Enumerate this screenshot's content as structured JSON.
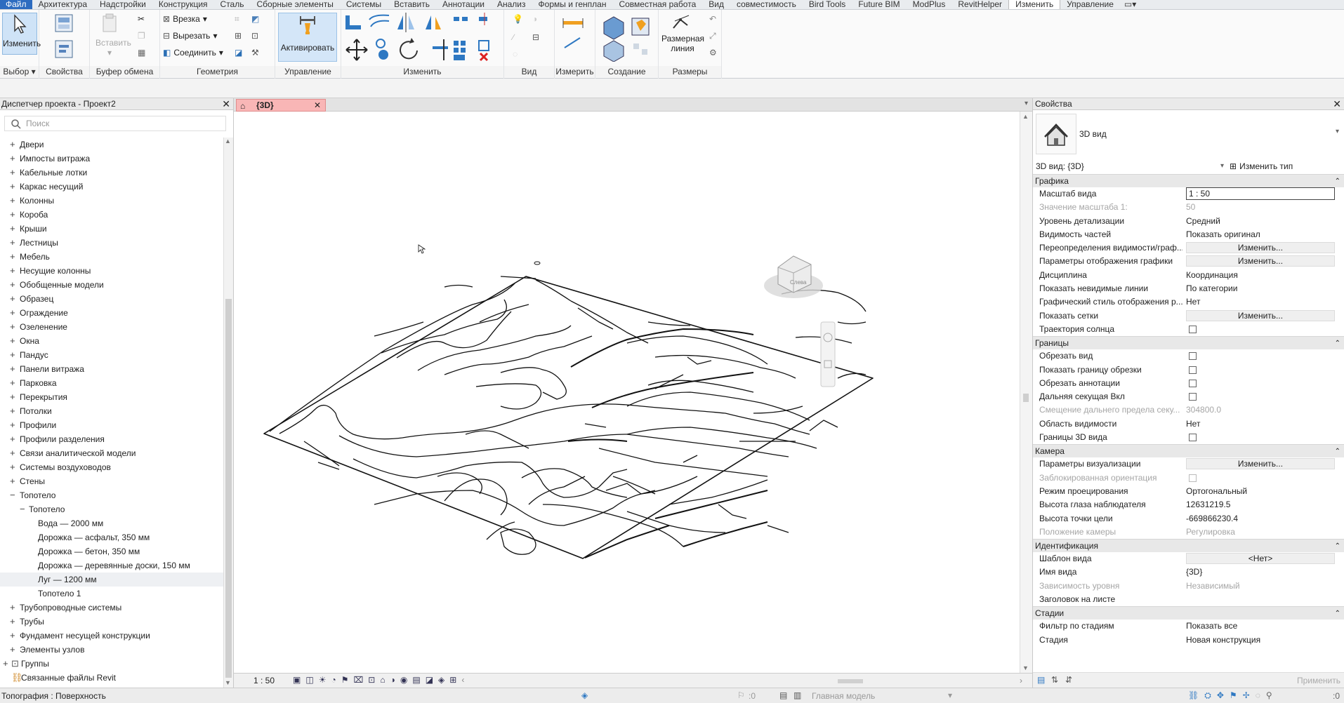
{
  "ribbon_tabs": [
    "Файл",
    "Архитектура",
    "Надстройки",
    "Конструкция",
    "Сталь",
    "Сборные элементы",
    "Системы",
    "Вставить",
    "Аннотации",
    "Анализ",
    "Формы и генплан",
    "Совместная работа",
    "Вид",
    "совместимость",
    "Bird Tools",
    "Future BIM",
    "ModPlus",
    "RevitHelper",
    "Изменить",
    "Управление"
  ],
  "ribbon": {
    "modify_label": "Изменить",
    "select_panel": "Выбор",
    "properties_panel": "Свойства",
    "clipboard_panel": "Буфер обмена",
    "paste_label": "Вставить",
    "cut_in_label": "Врезка",
    "cut_out_label": "Вырезать",
    "join_label": "Соединить",
    "geometry_panel": "Геометрия",
    "activate_label": "Активировать",
    "control_panel": "Управление",
    "modify_panel": "Изменить",
    "view_panel": "Вид",
    "measure_panel": "Измерить",
    "create_panel": "Создание",
    "dim_line_label_1": "Размерная",
    "dim_line_label_2": "линия",
    "dimensions_panel": "Размеры"
  },
  "browser": {
    "title": "Диспетчер проекта - Проект2",
    "search_placeholder": "Поиск",
    "items": [
      {
        "label": "Двери",
        "level": 1,
        "pm": "+"
      },
      {
        "label": "Импосты витража",
        "level": 1,
        "pm": "+"
      },
      {
        "label": "Кабельные лотки",
        "level": 1,
        "pm": "+"
      },
      {
        "label": "Каркас несущий",
        "level": 1,
        "pm": "+"
      },
      {
        "label": "Колонны",
        "level": 1,
        "pm": "+"
      },
      {
        "label": "Короба",
        "level": 1,
        "pm": "+"
      },
      {
        "label": "Крыши",
        "level": 1,
        "pm": "+"
      },
      {
        "label": "Лестницы",
        "level": 1,
        "pm": "+"
      },
      {
        "label": "Мебель",
        "level": 1,
        "pm": "+"
      },
      {
        "label": "Несущие колонны",
        "level": 1,
        "pm": "+"
      },
      {
        "label": "Обобщенные модели",
        "level": 1,
        "pm": "+"
      },
      {
        "label": "Образец",
        "level": 1,
        "pm": "+"
      },
      {
        "label": "Ограждение",
        "level": 1,
        "pm": "+"
      },
      {
        "label": "Озеленение",
        "level": 1,
        "pm": "+"
      },
      {
        "label": "Окна",
        "level": 1,
        "pm": "+"
      },
      {
        "label": "Пандус",
        "level": 1,
        "pm": "+"
      },
      {
        "label": "Панели витража",
        "level": 1,
        "pm": "+"
      },
      {
        "label": "Парковка",
        "level": 1,
        "pm": "+"
      },
      {
        "label": "Перекрытия",
        "level": 1,
        "pm": "+"
      },
      {
        "label": "Потолки",
        "level": 1,
        "pm": "+"
      },
      {
        "label": "Профили",
        "level": 1,
        "pm": "+"
      },
      {
        "label": "Профили разделения",
        "level": 1,
        "pm": "+"
      },
      {
        "label": "Связи аналитической модели",
        "level": 1,
        "pm": "+"
      },
      {
        "label": "Системы воздуховодов",
        "level": 1,
        "pm": "+"
      },
      {
        "label": "Стены",
        "level": 1,
        "pm": "+"
      },
      {
        "label": "Топотело",
        "level": 1,
        "pm": "−"
      },
      {
        "label": "Топотело",
        "level": 2,
        "pm": "−"
      },
      {
        "label": "Вода — 2000 мм",
        "level": 3,
        "pm": ""
      },
      {
        "label": "Дорожка — асфальт, 350 мм",
        "level": 3,
        "pm": ""
      },
      {
        "label": "Дорожка — бетон, 350 мм",
        "level": 3,
        "pm": ""
      },
      {
        "label": "Дорожка — деревянные доски, 150 мм",
        "level": 3,
        "pm": ""
      },
      {
        "label": "Луг — 1200 мм",
        "level": 3,
        "pm": "",
        "selected": true
      },
      {
        "label": "Топотело 1",
        "level": 3,
        "pm": ""
      },
      {
        "label": "Трубопроводные системы",
        "level": 1,
        "pm": "+"
      },
      {
        "label": "Трубы",
        "level": 1,
        "pm": "+"
      },
      {
        "label": "Фундамент несущей конструкции",
        "level": 1,
        "pm": "+"
      },
      {
        "label": "Элементы узлов",
        "level": 1,
        "pm": "+"
      },
      {
        "label": "Группы",
        "level": 0,
        "pm": "+"
      },
      {
        "label": "Связанные файлы Revit",
        "level": 0,
        "pm": ""
      }
    ]
  },
  "view": {
    "tab_label": "{3D}",
    "scale": "1 : 50",
    "viewcube_face": "Слева"
  },
  "properties": {
    "title": "Свойства",
    "type_name": "3D вид",
    "type_selector": "3D вид: {3D}",
    "edit_type": "Изменить тип",
    "groups": [
      {
        "name": "Графика",
        "rows": [
          {
            "k": "Масштаб вида",
            "v": "1 : 50",
            "kind": "input"
          },
          {
            "k": "Значение масштаба    1:",
            "v": "50",
            "kind": "text",
            "dim": true
          },
          {
            "k": "Уровень детализации",
            "v": "Средний",
            "kind": "text"
          },
          {
            "k": "Видимость частей",
            "v": "Показать оригинал",
            "kind": "text"
          },
          {
            "k": "Переопределения видимости/граф...",
            "v": "Изменить...",
            "kind": "button"
          },
          {
            "k": "Параметры отображения графики",
            "v": "Изменить...",
            "kind": "button"
          },
          {
            "k": "Дисциплина",
            "v": "Координация",
            "kind": "text"
          },
          {
            "k": "Показать невидимые линии",
            "v": "По категории",
            "kind": "text"
          },
          {
            "k": "Графический стиль отображения р...",
            "v": "Нет",
            "kind": "text"
          },
          {
            "k": "Показать сетки",
            "v": "Изменить...",
            "kind": "button"
          },
          {
            "k": "Траектория солнца",
            "v": "",
            "kind": "check"
          }
        ]
      },
      {
        "name": "Границы",
        "rows": [
          {
            "k": "Обрезать вид",
            "v": "",
            "kind": "check"
          },
          {
            "k": "Показать границу обрезки",
            "v": "",
            "kind": "check"
          },
          {
            "k": "Обрезать аннотации",
            "v": "",
            "kind": "check"
          },
          {
            "k": "Дальняя секущая Вкл",
            "v": "",
            "kind": "check"
          },
          {
            "k": "Смещение дальнего предела секу...",
            "v": "304800.0",
            "kind": "text",
            "dim": true
          },
          {
            "k": "Область видимости",
            "v": "Нет",
            "kind": "text"
          },
          {
            "k": "Границы 3D вида",
            "v": "",
            "kind": "check"
          }
        ]
      },
      {
        "name": "Камера",
        "rows": [
          {
            "k": "Параметры визуализации",
            "v": "Изменить...",
            "kind": "button"
          },
          {
            "k": "Заблокированная ориентация",
            "v": "",
            "kind": "check",
            "dim": true
          },
          {
            "k": "Режим проецирования",
            "v": "Ортогональный",
            "kind": "text"
          },
          {
            "k": "Высота глаза наблюдателя",
            "v": "12631219.5",
            "kind": "text"
          },
          {
            "k": "Высота точки цели",
            "v": "-669866230.4",
            "kind": "text"
          },
          {
            "k": "Положение камеры",
            "v": "Регулировка",
            "kind": "text",
            "dim": true
          }
        ]
      },
      {
        "name": "Идентификация",
        "rows": [
          {
            "k": "Шаблон вида",
            "v": "<Нет>",
            "kind": "button"
          },
          {
            "k": "Имя вида",
            "v": "{3D}",
            "kind": "text"
          },
          {
            "k": "Зависимость уровня",
            "v": "Независимый",
            "kind": "text",
            "dim": true
          },
          {
            "k": "Заголовок на листе",
            "v": "",
            "kind": "text"
          }
        ]
      },
      {
        "name": "Стадии",
        "rows": [
          {
            "k": "Фильтр по стадиям",
            "v": "Показать все",
            "kind": "text"
          },
          {
            "k": "Стадия",
            "v": "Новая конструкция",
            "kind": "text"
          }
        ]
      }
    ],
    "apply": "Применить"
  },
  "status": {
    "left": "Топография : Поверхность",
    "zero_a": ":0",
    "model": "Главная модель",
    "zero_b": ":0"
  }
}
